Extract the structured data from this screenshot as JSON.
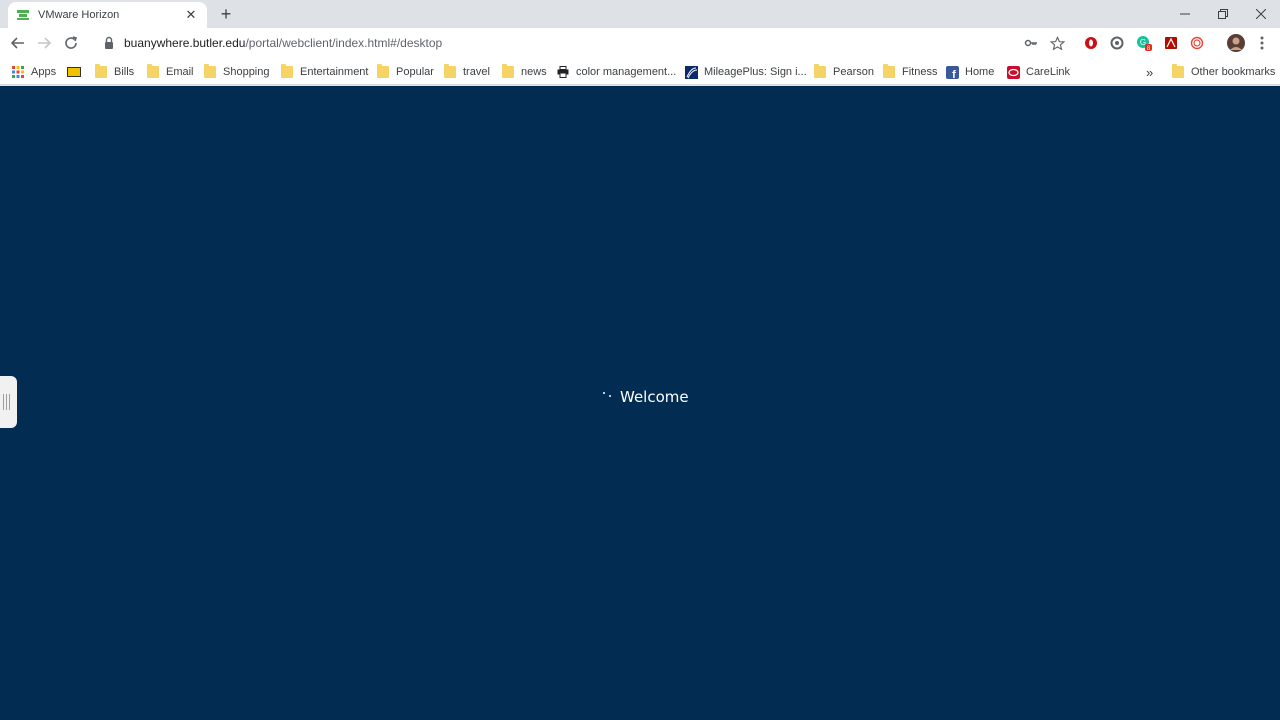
{
  "tab": {
    "title": "VMware Horizon"
  },
  "address_bar": {
    "host": "buanywhere.butler.edu",
    "path": "/portal/webclient/index.html#/desktop"
  },
  "bookmarks": [
    {
      "label": "Apps",
      "icon": "apps-grid-icon"
    },
    {
      "label": "",
      "icon": "yellow-card-icon"
    },
    {
      "label": "Bills",
      "icon": "folder-icon"
    },
    {
      "label": "Email",
      "icon": "folder-icon"
    },
    {
      "label": "Shopping",
      "icon": "folder-icon"
    },
    {
      "label": "Entertainment",
      "icon": "folder-icon"
    },
    {
      "label": "Popular",
      "icon": "folder-icon"
    },
    {
      "label": "travel",
      "icon": "folder-icon"
    },
    {
      "label": "news",
      "icon": "folder-icon"
    },
    {
      "label": "color management...",
      "icon": "printer-icon"
    },
    {
      "label": "MileagePlus: Sign i...",
      "icon": "united-icon"
    },
    {
      "label": "Pearson",
      "icon": "folder-icon"
    },
    {
      "label": "Fitness",
      "icon": "folder-icon"
    },
    {
      "label": "Home",
      "icon": "facebook-icon"
    },
    {
      "label": "CareLink",
      "icon": "carelink-icon"
    }
  ],
  "overflow_label": "»",
  "other_bookmarks": "Other bookmarks",
  "remote": {
    "status_text": "Welcome",
    "background": "#022c51"
  },
  "extension_badge": "8"
}
